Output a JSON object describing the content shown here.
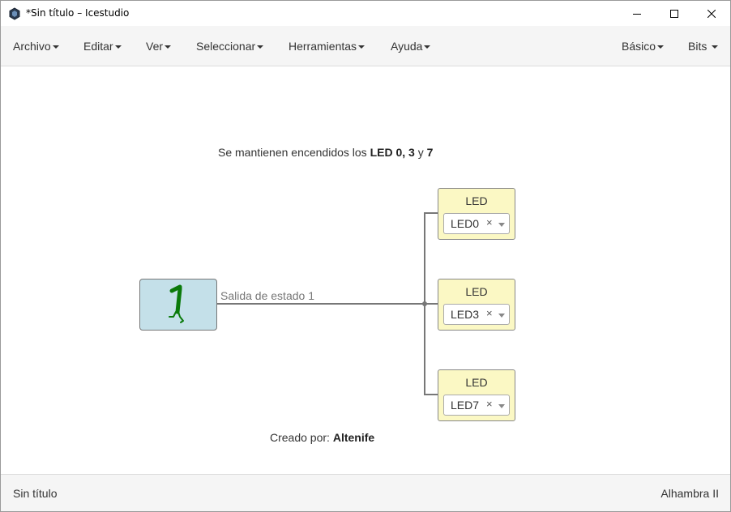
{
  "window": {
    "title": "*Sin título – Icestudio"
  },
  "menu": {
    "left": [
      {
        "label": "Archivo"
      },
      {
        "label": "Editar"
      },
      {
        "label": "Ver"
      },
      {
        "label": "Seleccionar"
      },
      {
        "label": "Herramientas"
      },
      {
        "label": "Ayuda"
      }
    ],
    "right": [
      {
        "label": "Básico"
      },
      {
        "label": "Bits"
      }
    ]
  },
  "canvas": {
    "info_top": {
      "prefix": "Se mantienen encendidos los ",
      "bold1": "LED 0",
      "sep": ", ",
      "bold2": "3",
      "and": " y ",
      "bold3": "7"
    },
    "info_bottom": {
      "prefix": "Creado por: ",
      "author": "Altenife"
    },
    "constant_block": {
      "value": "1",
      "icon": "walking-one-icon",
      "color": "#c4e0e9"
    },
    "wire_label": "Salida de estado 1",
    "led_blocks": [
      {
        "title": "LED",
        "selected": "LED0",
        "clear": "×"
      },
      {
        "title": "LED",
        "selected": "LED3",
        "clear": "×"
      },
      {
        "title": "LED",
        "selected": "LED7",
        "clear": "×"
      }
    ],
    "led_color": "#fbf8c4"
  },
  "status": {
    "file": "Sin título",
    "board": "Alhambra II"
  }
}
